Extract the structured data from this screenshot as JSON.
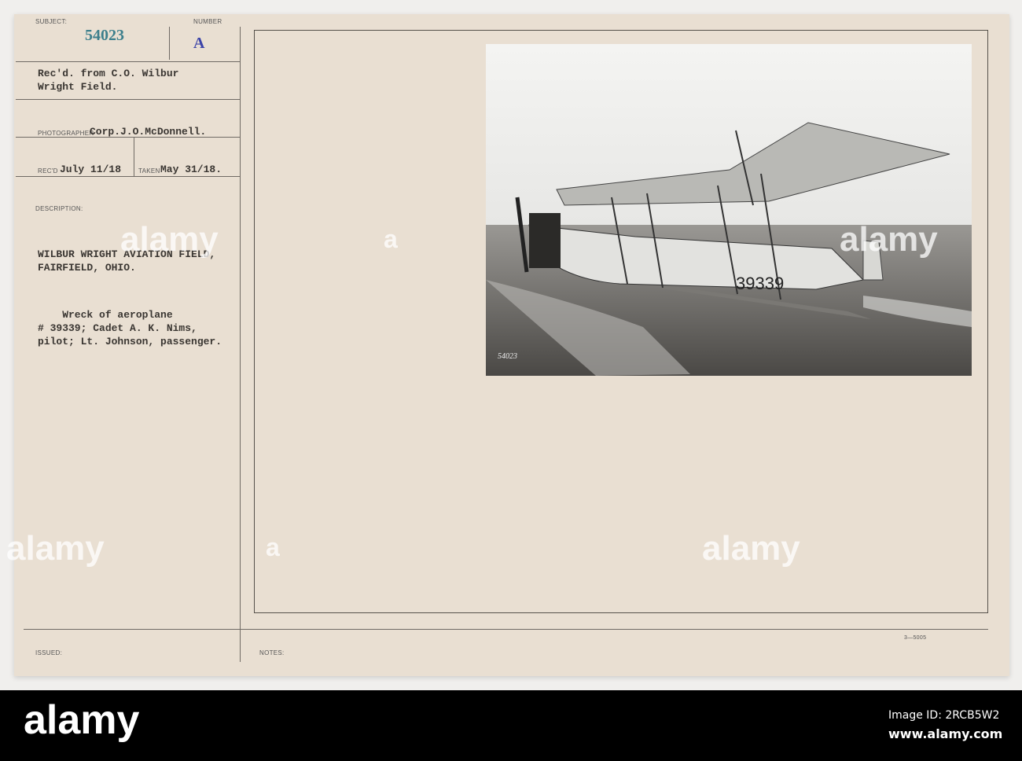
{
  "card": {
    "subject_label": "SUBJECT:",
    "subject_number": "54023",
    "number_label": "NUMBER",
    "number_value": "A",
    "received_from": [
      "Rec'd. from C.O. Wilbur",
      "Wright Field."
    ],
    "photographer_label": "PHOTOGRAPHER",
    "photographer": "Corp.J.O.McDonnell.",
    "recd_label": "REC'D",
    "recd_date": "July 11/18",
    "taken_label": "TAKEN",
    "taken_date": "May 31/18.",
    "description_label": "DESCRIPTION:",
    "description_location": [
      "WILBUR WRIGHT AVIATION FIELD,",
      "FAIRFIELD, OHIO."
    ],
    "description_body": [
      "    Wreck of aeroplane",
      "# 39339; Cadet A. K. Nims,",
      "pilot; Lt. Johnson, passenger."
    ],
    "issued_label": "ISSUED:",
    "notes_label": "NOTES:",
    "form_number": "3—5005",
    "photo_tail_number": "39339",
    "photo_negative_number": "54023"
  },
  "watermark": {
    "logo": "alamy",
    "mark": "a"
  },
  "footer": {
    "logo": "alamy",
    "image_id": "Image ID: 2RCB5W2",
    "url": "www.alamy.com"
  }
}
